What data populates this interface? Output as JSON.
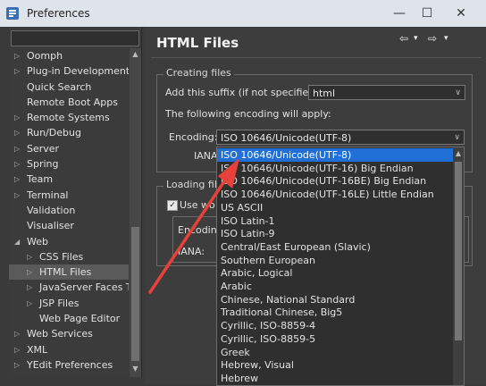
{
  "window": {
    "title": "Preferences",
    "minimize": "—",
    "maximize": "☐",
    "close": "✕"
  },
  "sidebar": {
    "items": [
      {
        "label": "Oomph",
        "indent": 0,
        "expander": "▷"
      },
      {
        "label": "Plug-in Development",
        "indent": 0,
        "expander": "▷"
      },
      {
        "label": "Quick Search",
        "indent": 0,
        "expander": ""
      },
      {
        "label": "Remote Boot Apps",
        "indent": 0,
        "expander": ""
      },
      {
        "label": "Remote Systems",
        "indent": 0,
        "expander": "▷"
      },
      {
        "label": "Run/Debug",
        "indent": 0,
        "expander": "▷"
      },
      {
        "label": "Server",
        "indent": 0,
        "expander": "▷"
      },
      {
        "label": "Spring",
        "indent": 0,
        "expander": "▷"
      },
      {
        "label": "Team",
        "indent": 0,
        "expander": "▷"
      },
      {
        "label": "Terminal",
        "indent": 0,
        "expander": "▷"
      },
      {
        "label": "Validation",
        "indent": 0,
        "expander": ""
      },
      {
        "label": "Visualiser",
        "indent": 0,
        "expander": ""
      },
      {
        "label": "Web",
        "indent": 0,
        "expander": "◢"
      },
      {
        "label": "CSS Files",
        "indent": 1,
        "expander": "▷"
      },
      {
        "label": "HTML Files",
        "indent": 1,
        "expander": "▷",
        "selected": true
      },
      {
        "label": "JavaServer Faces To",
        "indent": 1,
        "expander": "▷"
      },
      {
        "label": "JSP Files",
        "indent": 1,
        "expander": "▷"
      },
      {
        "label": "Web Page Editor",
        "indent": 1,
        "expander": ""
      },
      {
        "label": "Web Services",
        "indent": 0,
        "expander": "▷"
      },
      {
        "label": "XML",
        "indent": 0,
        "expander": "▷"
      },
      {
        "label": "YEdit Preferences",
        "indent": 0,
        "expander": "▷"
      }
    ]
  },
  "main": {
    "title": "HTML Files",
    "nav": {
      "back": "⇦",
      "back_menu": "▾",
      "forward": "⇨",
      "forward_menu": "▾"
    },
    "creating_files": {
      "legend": "Creating files",
      "suffix_label": "Add this suffix (if not specified):",
      "suffix_value": "html",
      "encoding_info": "The following encoding will apply:",
      "encoding_label": "Encoding:",
      "encoding_value": "ISO 10646/Unicode(UTF-8)",
      "iana_label": "IANA:"
    },
    "loading_files": {
      "legend": "Loading file",
      "checkbox_label": "Use wo",
      "encoding_label": "Encodin",
      "iana_label": "IANA:"
    }
  },
  "encoding_options": [
    "ISO 10646/Unicode(UTF-8)",
    "ISO 10646/Unicode(UTF-16) Big Endian",
    "ISO 10646/Unicode(UTF-16BE) Big Endian",
    "ISO 10646/Unicode(UTF-16LE) Little Endian",
    "US ASCII",
    "ISO Latin-1",
    "ISO Latin-9",
    "Central/East European (Slavic)",
    "Southern European",
    "Arabic, Logical",
    "Arabic",
    "Chinese, National Standard",
    "Traditional Chinese, Big5",
    "Cyrillic, ISO-8859-4",
    "Cyrillic, ISO-8859-5",
    "Greek",
    "Hebrew, Visual",
    "Hebrew"
  ],
  "selected_encoding_index": 0,
  "colors": {
    "selection": "#1f6fd6",
    "annotation_arrow": "#e8413a"
  }
}
